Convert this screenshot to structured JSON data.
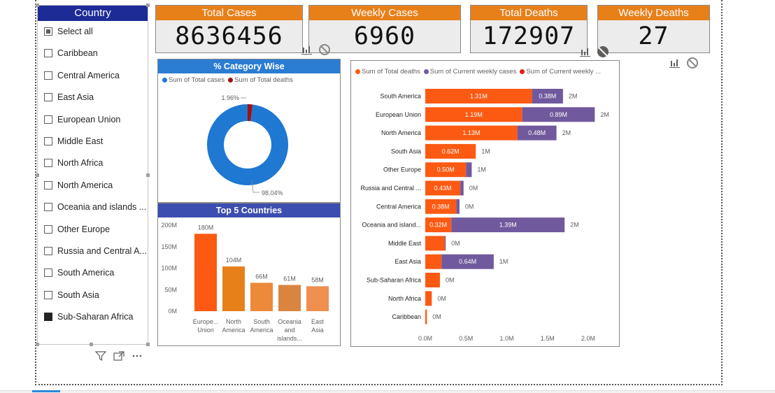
{
  "slicer": {
    "title": "Country",
    "items": [
      {
        "label": "Select all",
        "state": "partial"
      },
      {
        "label": "Caribbean",
        "state": "unchecked"
      },
      {
        "label": "Central America",
        "state": "unchecked"
      },
      {
        "label": "East Asia",
        "state": "unchecked"
      },
      {
        "label": "European Union",
        "state": "unchecked"
      },
      {
        "label": "Middle East",
        "state": "unchecked"
      },
      {
        "label": "North Africa",
        "state": "unchecked"
      },
      {
        "label": "North America",
        "state": "unchecked"
      },
      {
        "label": "Oceania and islands ...",
        "state": "unchecked"
      },
      {
        "label": "Other Europe",
        "state": "unchecked"
      },
      {
        "label": "Russia and Central A...",
        "state": "unchecked"
      },
      {
        "label": "South America",
        "state": "unchecked"
      },
      {
        "label": "South Asia",
        "state": "unchecked"
      },
      {
        "label": "Sub-Saharan Africa",
        "state": "checked"
      }
    ]
  },
  "cards": [
    {
      "title": "Total Cases",
      "value": "8636456"
    },
    {
      "title": "Weekly Cases",
      "value": "6960"
    },
    {
      "title": "Total Deaths",
      "value": "172907"
    },
    {
      "title": "Weekly Deaths",
      "value": "27"
    }
  ],
  "colors": {
    "header_blue": "#1d2b97",
    "card_orange": "#e8801a",
    "donut_blue": "#1f78d1",
    "donut_red": "#a01010",
    "bar_orange": "#fc5a12",
    "bar_purple": "#71599d",
    "bar_red": "#e81a1a",
    "panel_blue": "#2b7cd3",
    "panel_indigo": "#3c4eb0"
  },
  "icons": [
    "chart-filter-icon",
    "ban-icon",
    "filter-icon",
    "focus-mode-icon",
    "more-options-icon"
  ],
  "chart_data": [
    {
      "type": "pie",
      "title": "% Category Wise",
      "legend": [
        "Sum of Total cases",
        "Sum of Total deaths"
      ],
      "values": [
        98.04,
        1.96
      ],
      "labels": [
        "98.04%",
        "1.96%"
      ]
    },
    {
      "type": "bar",
      "title": "Top 5 Countries",
      "categories": [
        "Europe... Union",
        "North America",
        "South America",
        "Oceania and islands...",
        "East Asia"
      ],
      "category_lines": [
        [
          "Europe...",
          "Union"
        ],
        [
          "North",
          "America"
        ],
        [
          "South",
          "America"
        ],
        [
          "Oceania",
          "and",
          "islands..."
        ],
        [
          "East",
          "Asia"
        ]
      ],
      "values": [
        180,
        104,
        66,
        61,
        58
      ],
      "data_labels": [
        "180M",
        "104M",
        "66M",
        "61M",
        "58M"
      ],
      "colors": [
        "#fc5a12",
        "#e8801a",
        "#ec8a3a",
        "#d98540",
        "#ef8f50"
      ],
      "y_ticks": [
        "200M",
        "150M",
        "100M",
        "50M",
        "0M"
      ],
      "ylim": [
        0,
        200
      ]
    },
    {
      "type": "bar",
      "orientation": "horizontal",
      "stacked": true,
      "legend": [
        "Sum of Total deaths",
        "Sum of Current weekly cases",
        "Sum of Current weekly ..."
      ],
      "categories": [
        "South America",
        "European Union",
        "North America",
        "South Asia",
        "Other Europe",
        "Russia and Central ...",
        "Central America",
        "Oceania and island...",
        "Middle East",
        "East Asia",
        "Sub-Saharan Africa",
        "North Africa",
        "Caribbean"
      ],
      "series": [
        {
          "name": "Sum of Total deaths",
          "values": [
            1.31,
            1.19,
            1.13,
            0.62,
            0.5,
            0.43,
            0.38,
            0.32,
            0.24,
            0.2,
            0.18,
            0.08,
            0.02
          ],
          "labels": [
            "1.31M",
            "1.19M",
            "1.13M",
            "0.62M",
            "0.50M",
            "0.43M",
            "0.38M",
            "0.32M",
            "",
            "",
            "",
            "",
            ""
          ]
        },
        {
          "name": "Sum of Current weekly cases",
          "values": [
            0.38,
            0.89,
            0.48,
            0.0,
            0.07,
            0.04,
            0.04,
            1.39,
            0.01,
            0.64,
            0.0,
            0.0,
            0.0
          ],
          "labels": [
            "0.38M",
            "0.89M",
            "0.48M",
            "",
            "",
            "",
            "",
            "1.39M",
            "",
            "0.64M",
            "",
            "",
            ""
          ]
        }
      ],
      "total_labels": [
        "2M",
        "2M",
        "2M",
        "1M",
        "1M",
        "0M",
        "0M",
        "2M",
        "0M",
        "1M",
        "0M",
        "0M",
        "0M"
      ],
      "x_ticks": [
        "0.0M",
        "0.5M",
        "1.0M",
        "1.5M",
        "2.0M"
      ],
      "xlim": [
        0,
        2.0
      ]
    }
  ]
}
